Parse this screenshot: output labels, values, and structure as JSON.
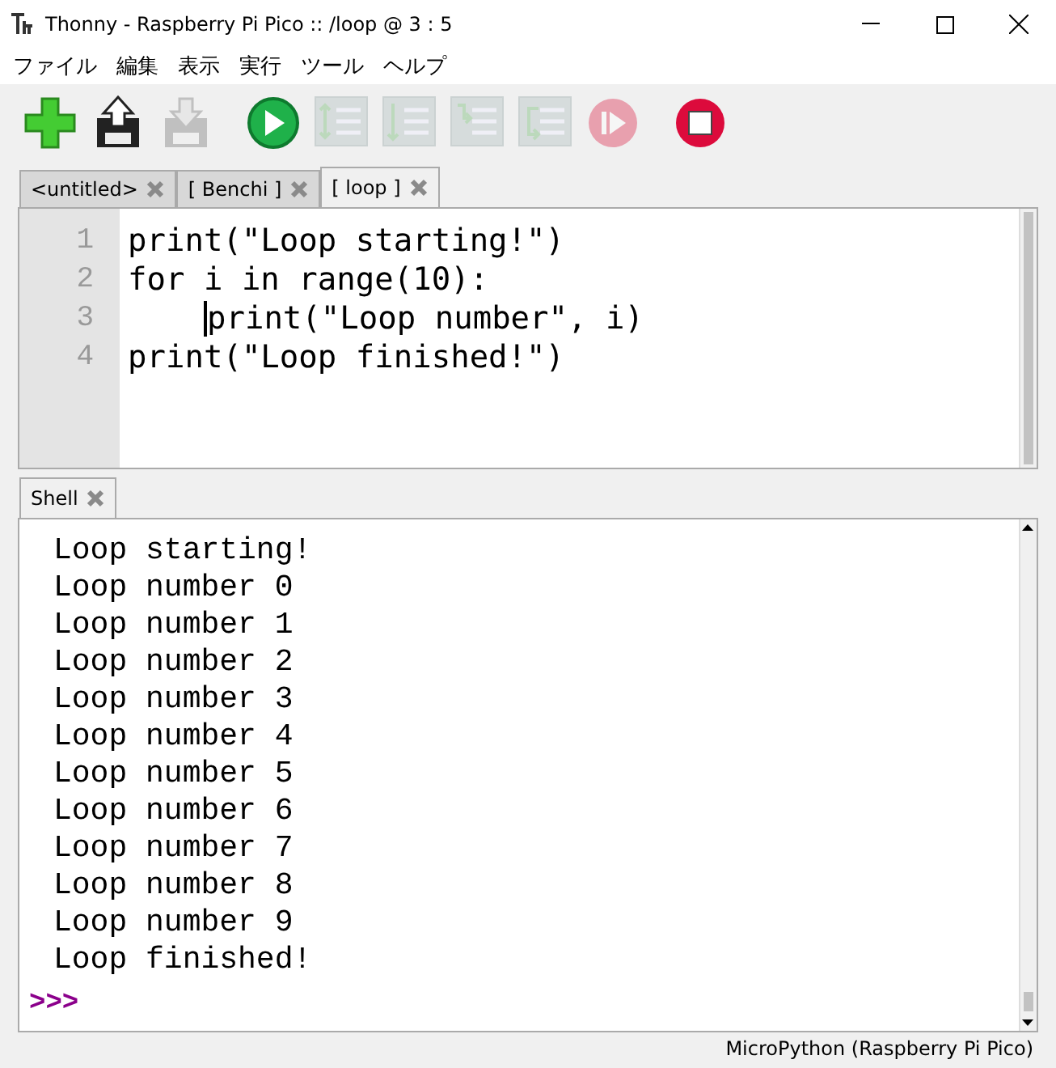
{
  "window": {
    "title": "Thonny  -  Raspberry Pi Pico :: /loop  @  3 : 5"
  },
  "menu": [
    "ファイル",
    "編集",
    "表示",
    "実行",
    "ツール",
    "ヘルプ"
  ],
  "toolbar": [
    {
      "kind": "new",
      "disabled": false
    },
    {
      "kind": "load",
      "disabled": false
    },
    {
      "kind": "save",
      "disabled": true
    },
    {
      "kind": "run",
      "disabled": false
    },
    {
      "kind": "debug",
      "disabled": true
    },
    {
      "kind": "step-over",
      "disabled": true
    },
    {
      "kind": "step-into",
      "disabled": true
    },
    {
      "kind": "step-out",
      "disabled": true
    },
    {
      "kind": "resume",
      "disabled": true
    },
    {
      "kind": "stop",
      "disabled": false
    }
  ],
  "editor_tabs": [
    {
      "label": "<untitled>",
      "selected": false
    },
    {
      "label": "[ Benchi ]",
      "selected": false
    },
    {
      "label": "[ loop ]",
      "selected": true
    }
  ],
  "editor": {
    "lines": [
      {
        "number": "1",
        "code": "print(\"Loop starting!\")",
        "cursor": false
      },
      {
        "number": "2",
        "code": "for i in range(10):",
        "cursor": false
      },
      {
        "number": "3",
        "code": "    print(\"Loop number\", i)",
        "cursor": true
      },
      {
        "number": "4",
        "code": "print(\"Loop finished!\")",
        "cursor": false
      }
    ]
  },
  "shell": {
    "tab": {
      "label": "Shell",
      "selected": true
    },
    "output": [
      "Loop starting!",
      "Loop number 0",
      "Loop number 1",
      "Loop number 2",
      "Loop number 3",
      "Loop number 4",
      "Loop number 5",
      "Loop number 6",
      "Loop number 7",
      "Loop number 8",
      "Loop number 9",
      "Loop finished!"
    ],
    "prompt": ">>>"
  },
  "status_bar": {
    "interpreter": "MicroPython (Raspberry Pi Pico)"
  }
}
